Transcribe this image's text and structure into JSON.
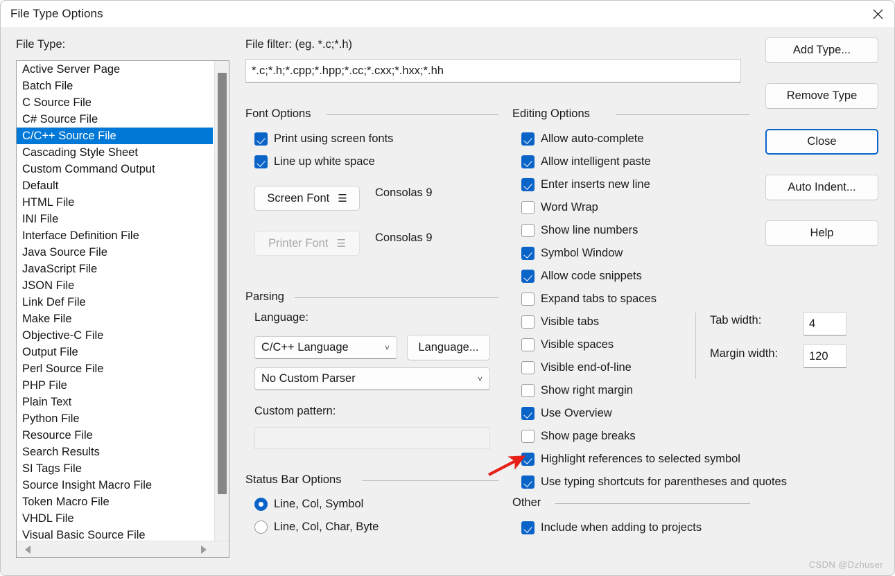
{
  "window": {
    "title": "File Type Options",
    "close_icon": "close-icon",
    "watermark": "CSDN @Dzhuser"
  },
  "colors": {
    "accent": "#0a64c8",
    "selection": "#0078d7",
    "dialog_bg": "#f0f0f0",
    "titlebar_bg": "#ffffff",
    "annotation_arrow": "#e8201a"
  },
  "file_type": {
    "label": "File Type:",
    "selected": "C/C++ Source File",
    "items": [
      "Active Server Page",
      "Batch File",
      "C Source File",
      "C# Source File",
      "C/C++ Source File",
      "Cascading Style Sheet",
      "Custom Command Output",
      "Default",
      "HTML File",
      "INI File",
      "Interface Definition File",
      "Java Source File",
      "JavaScript File",
      "JSON File",
      "Link Def File",
      "Make File",
      "Objective-C File",
      "Output File",
      "Perl Source File",
      "PHP File",
      "Plain Text",
      "Python File",
      "Resource File",
      "Search Results",
      "SI Tags File",
      "Source Insight Macro File",
      "Token Macro File",
      "VHDL File",
      "Visual Basic Source File"
    ]
  },
  "file_filter": {
    "label": "File filter: (eg. *.c;*.h)",
    "value": "*.c;*.h;*.cpp;*.hpp;*.cc;*.cxx;*.hxx;*.hh",
    "placeholder": ""
  },
  "font_options": {
    "caption": "Font Options",
    "checkboxes": [
      {
        "label": "Print using screen fonts",
        "checked": true
      },
      {
        "label": "Line up white space",
        "checked": true
      }
    ],
    "screen_font_button": "Screen Font",
    "screen_font_value": "Consolas 9",
    "printer_font_button": "Printer Font",
    "printer_font_value": "Consolas 9",
    "printer_font_disabled": true
  },
  "parsing": {
    "caption": "Parsing",
    "language_label": "Language:",
    "language_value": "C/C++ Language",
    "language_button": "Language...",
    "parser_value": "No Custom Parser",
    "custom_pattern_label": "Custom pattern:",
    "custom_pattern_value": ""
  },
  "status_bar": {
    "caption": "Status Bar Options",
    "options": [
      {
        "label": "Line, Col, Symbol",
        "selected": true
      },
      {
        "label": "Line, Col, Char, Byte",
        "selected": false
      }
    ]
  },
  "editing": {
    "caption": "Editing Options",
    "checkboxes": [
      {
        "label": "Allow auto-complete",
        "checked": true
      },
      {
        "label": "Allow intelligent paste",
        "checked": true
      },
      {
        "label": "Enter inserts new line",
        "checked": true
      },
      {
        "label": "Word Wrap",
        "checked": false
      },
      {
        "label": "Show line numbers",
        "checked": false
      },
      {
        "label": "Symbol Window",
        "checked": true
      },
      {
        "label": "Allow code snippets",
        "checked": true
      },
      {
        "label": "Expand tabs to spaces",
        "checked": false
      },
      {
        "label": "Visible tabs",
        "checked": false
      },
      {
        "label": "Visible spaces",
        "checked": false
      },
      {
        "label": "Visible end-of-line",
        "checked": false
      },
      {
        "label": "Show right margin",
        "checked": false
      },
      {
        "label": "Use Overview",
        "checked": true
      },
      {
        "label": "Show page breaks",
        "checked": false
      },
      {
        "label": "Highlight references to selected symbol",
        "checked": true
      },
      {
        "label": "Use typing shortcuts for parentheses and quotes",
        "checked": true
      }
    ],
    "tab_width_label": "Tab width:",
    "tab_width_value": "4",
    "margin_width_label": "Margin width:",
    "margin_width_value": "120"
  },
  "other": {
    "caption": "Other",
    "checkboxes": [
      {
        "label": "Include when adding to projects",
        "checked": true
      }
    ]
  },
  "buttons": {
    "add_type": "Add Type...",
    "remove_type": "Remove Type",
    "close": "Close",
    "auto_indent": "Auto Indent...",
    "help": "Help"
  }
}
